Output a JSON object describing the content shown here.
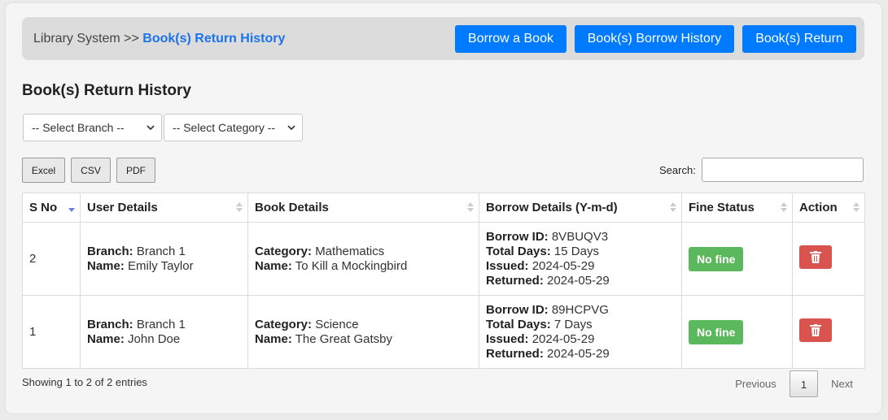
{
  "breadcrumb": {
    "root": "Library System >>",
    "current": "Book(s) Return History"
  },
  "nav": {
    "borrow": "Borrow a Book",
    "borrow_history": "Book(s) Borrow History",
    "return": "Book(s) Return"
  },
  "page_title": "Book(s) Return History",
  "filters": {
    "branch": "-- Select Branch --",
    "category": "-- Select Category --"
  },
  "export": {
    "excel": "Excel",
    "csv": "CSV",
    "pdf": "PDF"
  },
  "search": {
    "label": "Search:",
    "value": ""
  },
  "table": {
    "headers": [
      "S No",
      "User Details",
      "Book Details",
      "Borrow Details (Y-m-d)",
      "Fine Status",
      "Action"
    ],
    "labels": {
      "branch": "Branch:",
      "name": "Name:",
      "category": "Category:",
      "borrow_id": "Borrow ID:",
      "total_days": "Total Days:",
      "issued": "Issued:",
      "returned": "Returned:"
    },
    "rows": [
      {
        "sno": "2",
        "branch": "Branch 1",
        "user": "Emily Taylor",
        "category": "Mathematics",
        "book": "To Kill a Mockingbird",
        "borrow_id": "8VBUQV3",
        "total_days": "15 Days",
        "issued": "2024-05-29",
        "returned": "2024-05-29",
        "fine": "No fine"
      },
      {
        "sno": "1",
        "branch": "Branch 1",
        "user": "John Doe",
        "category": "Science",
        "book": "The Great Gatsby",
        "borrow_id": "89HCPVG",
        "total_days": "7 Days",
        "issued": "2024-05-29",
        "returned": "2024-05-29",
        "fine": "No fine"
      }
    ]
  },
  "footer": {
    "info": "Showing 1 to 2 of 2 entries",
    "previous": "Previous",
    "page": "1",
    "next": "Next"
  },
  "colors": {
    "primary": "#007bff",
    "success": "#5cb85c",
    "danger": "#d9534f",
    "breadcrumb_active": "#1a73e8"
  },
  "icons": {
    "delete": "trash-icon",
    "dropdown": "chevron-down-icon",
    "sort": "sort-icon"
  }
}
